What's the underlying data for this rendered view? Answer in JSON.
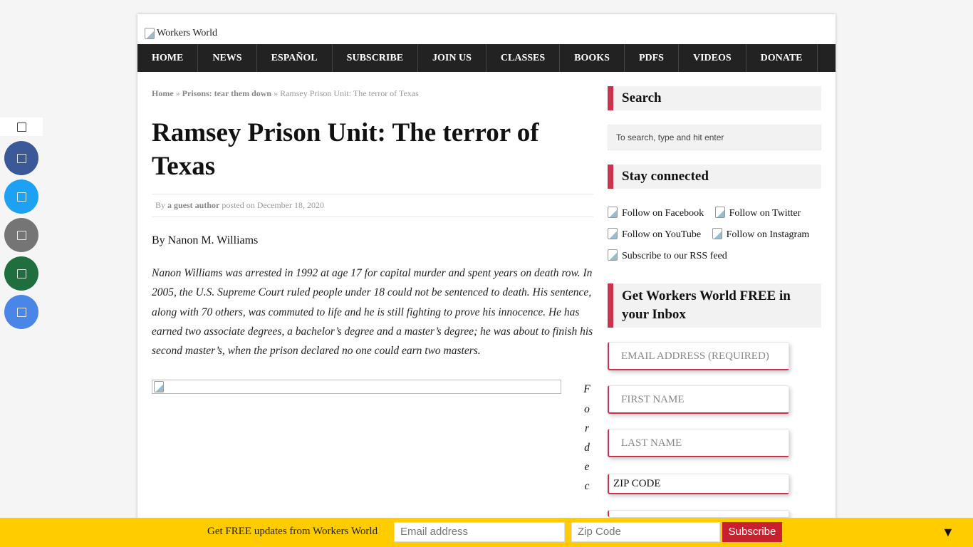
{
  "site": {
    "logo_alt": "Workers World"
  },
  "nav": {
    "items": [
      "HOME",
      "NEWS",
      "ESPAÑOL",
      "SUBSCRIBE",
      "JOIN US",
      "CLASSES",
      "BOOKS",
      "PDFS",
      "VIDEOS",
      "DONATE"
    ]
  },
  "breadcrumb": {
    "home": "Home",
    "sep1": "»",
    "category": "Prisons: tear them down",
    "sep2": "»",
    "current": "Ramsey Prison Unit: The terror of Texas"
  },
  "article": {
    "title": "Ramsey Prison Unit: The terror of Texas",
    "meta_by": "By",
    "meta_author": "a guest author",
    "meta_posted": "posted on December 18, 2020",
    "byline": "By Nanon M. Williams",
    "intro": "Nanon Williams was arrested in 1992 at age 17 for capital murder and spent years on death row. In 2005, the U.S. Supreme Court ruled people under 18 could not be sentenced to death. His sentence, along with 70 others, was commuted to life and he is still fighting to prove his innocence. He has earned two associate degrees, a bachelor’s degree and a master’s degree; he was about to finish his second master’s, when the prison declared no one could earn two masters.",
    "vertical_letters": [
      "F",
      "o",
      "r",
      "d",
      "e",
      "c"
    ]
  },
  "sidebar": {
    "search_title": "Search",
    "search_placeholder": "To search, type and hit enter",
    "connected_title": "Stay connected",
    "social": [
      "Follow on Facebook",
      "Follow on Twitter",
      "Follow on YouTube",
      "Follow on Instagram",
      "Subscribe to our RSS feed"
    ],
    "subscribe_title": "Get Workers World FREE in your Inbox",
    "fields": {
      "email": "EMAIL ADDRESS (REQUIRED)",
      "first": "FIRST NAME",
      "last": "LAST NAME",
      "zip": "ZIP CODE"
    }
  },
  "share": {
    "colors": {
      "facebook": "#3b5998",
      "twitter": "#1da1f2",
      "email": "#757575",
      "sms": "#1e6e3e",
      "google": "#4a86e8"
    }
  },
  "footer": {
    "text": "Get FREE updates from Workers World",
    "email_placeholder": "Email address",
    "zip_placeholder": "Zip Code",
    "button": "Subscribe",
    "toggle": "▼"
  },
  "colors": {
    "accent": "#c9344c",
    "nav_bg": "#222222",
    "footer_bg": "#ffcc00",
    "footer_button": "#c8202f"
  }
}
